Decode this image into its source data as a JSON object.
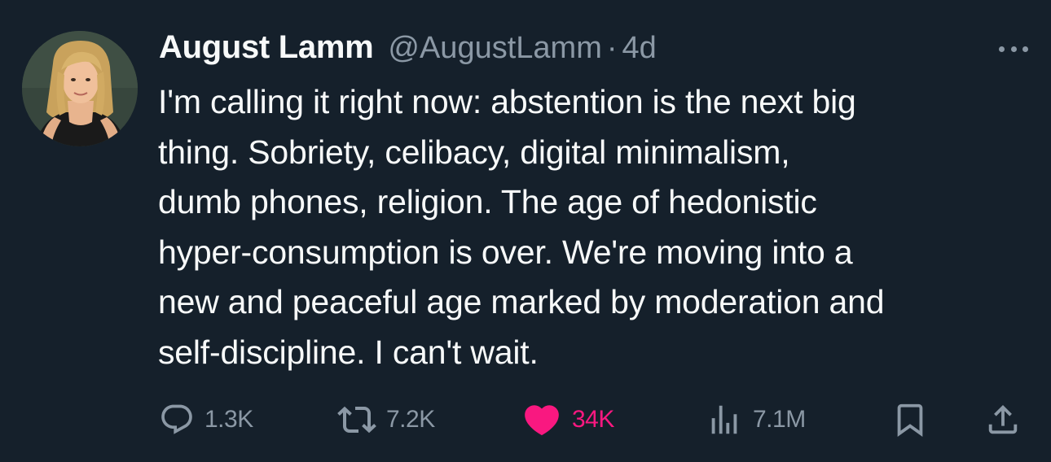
{
  "tweet": {
    "display_name": "August Lamm",
    "handle": "@AugustLamm",
    "separator": "·",
    "time": "4d",
    "body_lines": [
      "I'm calling it right now: abstention is the next big",
      "thing. Sobriety, celibacy, digital minimalism,",
      "dumb phones, religion. The age of hedonistic",
      "hyper-consumption is over. We're moving into a",
      "new and peaceful age marked by moderation and",
      "self-discipline. I can't wait."
    ]
  },
  "actions": {
    "reply": {
      "icon": "reply-icon",
      "count": "1.3K"
    },
    "repost": {
      "icon": "repost-icon",
      "count": "7.2K"
    },
    "like": {
      "icon": "heart-icon",
      "count": "34K",
      "liked": true
    },
    "views": {
      "icon": "views-icon",
      "count": "7.1M"
    },
    "bookmark": {
      "icon": "bookmark-icon"
    },
    "share": {
      "icon": "share-icon"
    }
  },
  "colors": {
    "background": "#15202b",
    "text": "#f7f9f9",
    "secondary": "#8b98a5",
    "like": "#f91880"
  }
}
